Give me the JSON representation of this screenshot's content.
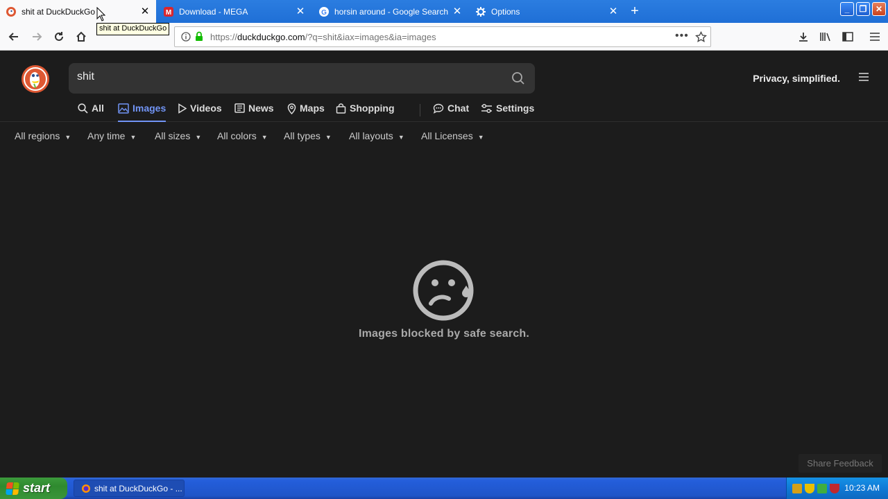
{
  "browser": {
    "tabs": [
      {
        "title": "shit at DuckDuckGo",
        "active": true
      },
      {
        "title": "Download - MEGA",
        "active": false
      },
      {
        "title": "horsin around - Google Search",
        "active": false
      },
      {
        "title": "Options",
        "active": false
      }
    ],
    "tooltip": "shit at DuckDuckGo",
    "url": {
      "prefix": "https://",
      "host": "duckduckgo.com",
      "path": "/?q=shit&iax=images&ia=images"
    }
  },
  "ddg": {
    "search_query": "shit",
    "tagline": "Privacy, simplified.",
    "tabs": [
      {
        "label": "All"
      },
      {
        "label": "Images"
      },
      {
        "label": "Videos"
      },
      {
        "label": "News"
      },
      {
        "label": "Maps"
      },
      {
        "label": "Shopping"
      },
      {
        "label": "Chat"
      },
      {
        "label": "Settings"
      }
    ],
    "filters": [
      "All regions",
      "Any time",
      "All sizes",
      "All colors",
      "All types",
      "All layouts",
      "All Licenses"
    ],
    "empty_message": "Images blocked by safe search.",
    "feedback_label": "Share Feedback"
  },
  "taskbar": {
    "start_label": "start",
    "task_item": "shit at DuckDuckGo - ...",
    "clock": "10:23 AM"
  },
  "colors": {
    "accent": "#7295f6",
    "page_bg": "#1c1c1c",
    "search_bg": "#333333"
  }
}
